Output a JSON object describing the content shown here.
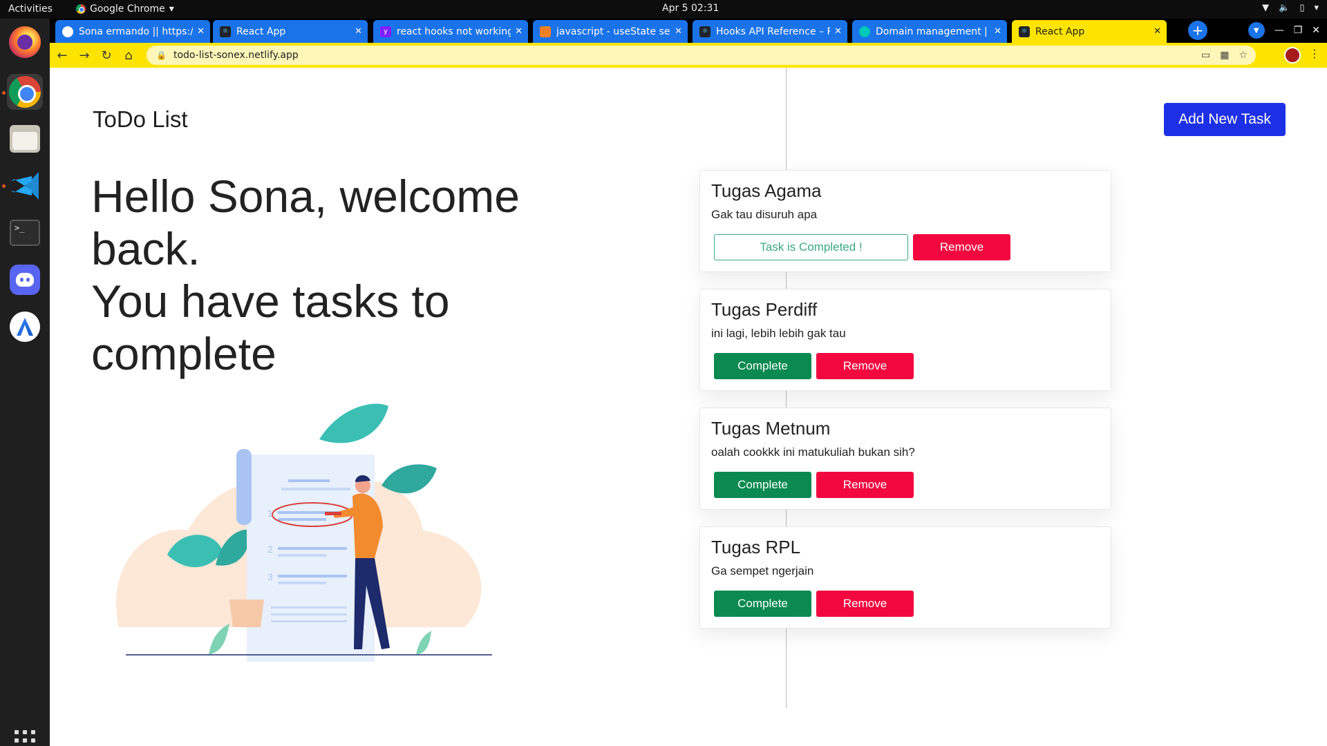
{
  "system": {
    "activities": "Activities",
    "app_menu": "Google Chrome",
    "clock": "Apr 5  02:31"
  },
  "browser": {
    "tabs": [
      {
        "title": "Sona ermando || https://",
        "favicon": "github-icon"
      },
      {
        "title": "React App",
        "favicon": "react-icon"
      },
      {
        "title": "react hooks not working",
        "favicon": "yahoo-icon"
      },
      {
        "title": "javascript - useState set",
        "favicon": "stackoverflow-icon"
      },
      {
        "title": "Hooks API Reference – R",
        "favicon": "react-icon"
      },
      {
        "title": "Domain management | S",
        "favicon": "netlify-icon"
      },
      {
        "title": "React App",
        "favicon": "react-icon",
        "active": true
      }
    ],
    "url": "todo-list-sonex.netlify.app",
    "accent": "#1a73e8",
    "active_tab_color": "#fde400"
  },
  "app": {
    "brand": "ToDo List",
    "add_button": "Add New Task",
    "greeting_line1": "Hello Sona, welcome back.",
    "greeting_line2": "You have tasks to complete",
    "colors": {
      "primary": "#1d30e6",
      "complete": "#0a8a50",
      "remove": "#f2083f",
      "completed_outline": "#3aa883"
    },
    "tasks": [
      {
        "title": "Tugas Agama",
        "description": "Gak tau disuruh apa",
        "completed": true,
        "complete_label": "Task is Completed !",
        "remove_label": "Remove"
      },
      {
        "title": "Tugas Perdiff",
        "description": "ini lagi, lebih lebih gak tau",
        "completed": false,
        "complete_label": "Complete",
        "remove_label": "Remove"
      },
      {
        "title": "Tugas Metnum",
        "description": "oalah cookkk ini matukuliah bukan sih?",
        "completed": false,
        "complete_label": "Complete",
        "remove_label": "Remove"
      },
      {
        "title": "Tugas RPL",
        "description": "Ga sempet ngerjain",
        "completed": false,
        "complete_label": "Complete",
        "remove_label": "Remove"
      }
    ],
    "illustration_numbers": [
      "1",
      "2",
      "3"
    ]
  }
}
